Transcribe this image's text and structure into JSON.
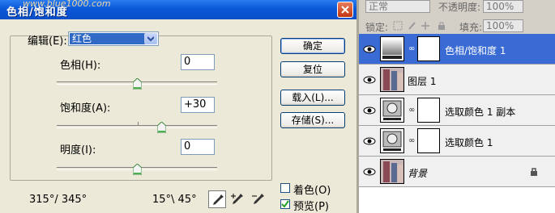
{
  "dialog": {
    "title": "色相/饱和度",
    "watermark": "www.blue1000.com",
    "edit_label": "编辑(E):",
    "edit_value": "红色",
    "hue_label": "色相(H):",
    "hue_value": "0",
    "saturation_label": "饱和度(A):",
    "saturation_value": "+30",
    "lightness_label": "明度(I):",
    "lightness_value": "0",
    "range_left": "315°/ 345°",
    "range_right": "15°\\ 45°",
    "buttons": {
      "ok": "确定",
      "reset": "复位",
      "load": "载入(L)...",
      "save": "存储(S)..."
    },
    "colorize_label": "着色(O)",
    "colorize_checked": false,
    "preview_label": "预览(P)",
    "preview_checked": true
  },
  "layers_panel": {
    "blend_mode": "正常",
    "opacity_label": "不透明度:",
    "opacity_value": "100%",
    "lock_label": "锁定:",
    "fill_label": "填充:",
    "fill_value": "100%",
    "layers": [
      {
        "name": "色相/饱和度 1",
        "type": "adjustment",
        "selected": true
      },
      {
        "name": "图层 1",
        "type": "photo",
        "selected": false
      },
      {
        "name": "选取颜色 1 副本",
        "type": "adjustment",
        "selected": false
      },
      {
        "name": "选取颜色 1",
        "type": "adjustment",
        "selected": false
      },
      {
        "name": "背景",
        "type": "photo",
        "selected": false
      }
    ]
  },
  "colors": {
    "title_bar": "#0a57d8",
    "selection": "#316ac5",
    "active_layer": "#3a6ad4",
    "dialog_bg": "#ece9d8"
  }
}
